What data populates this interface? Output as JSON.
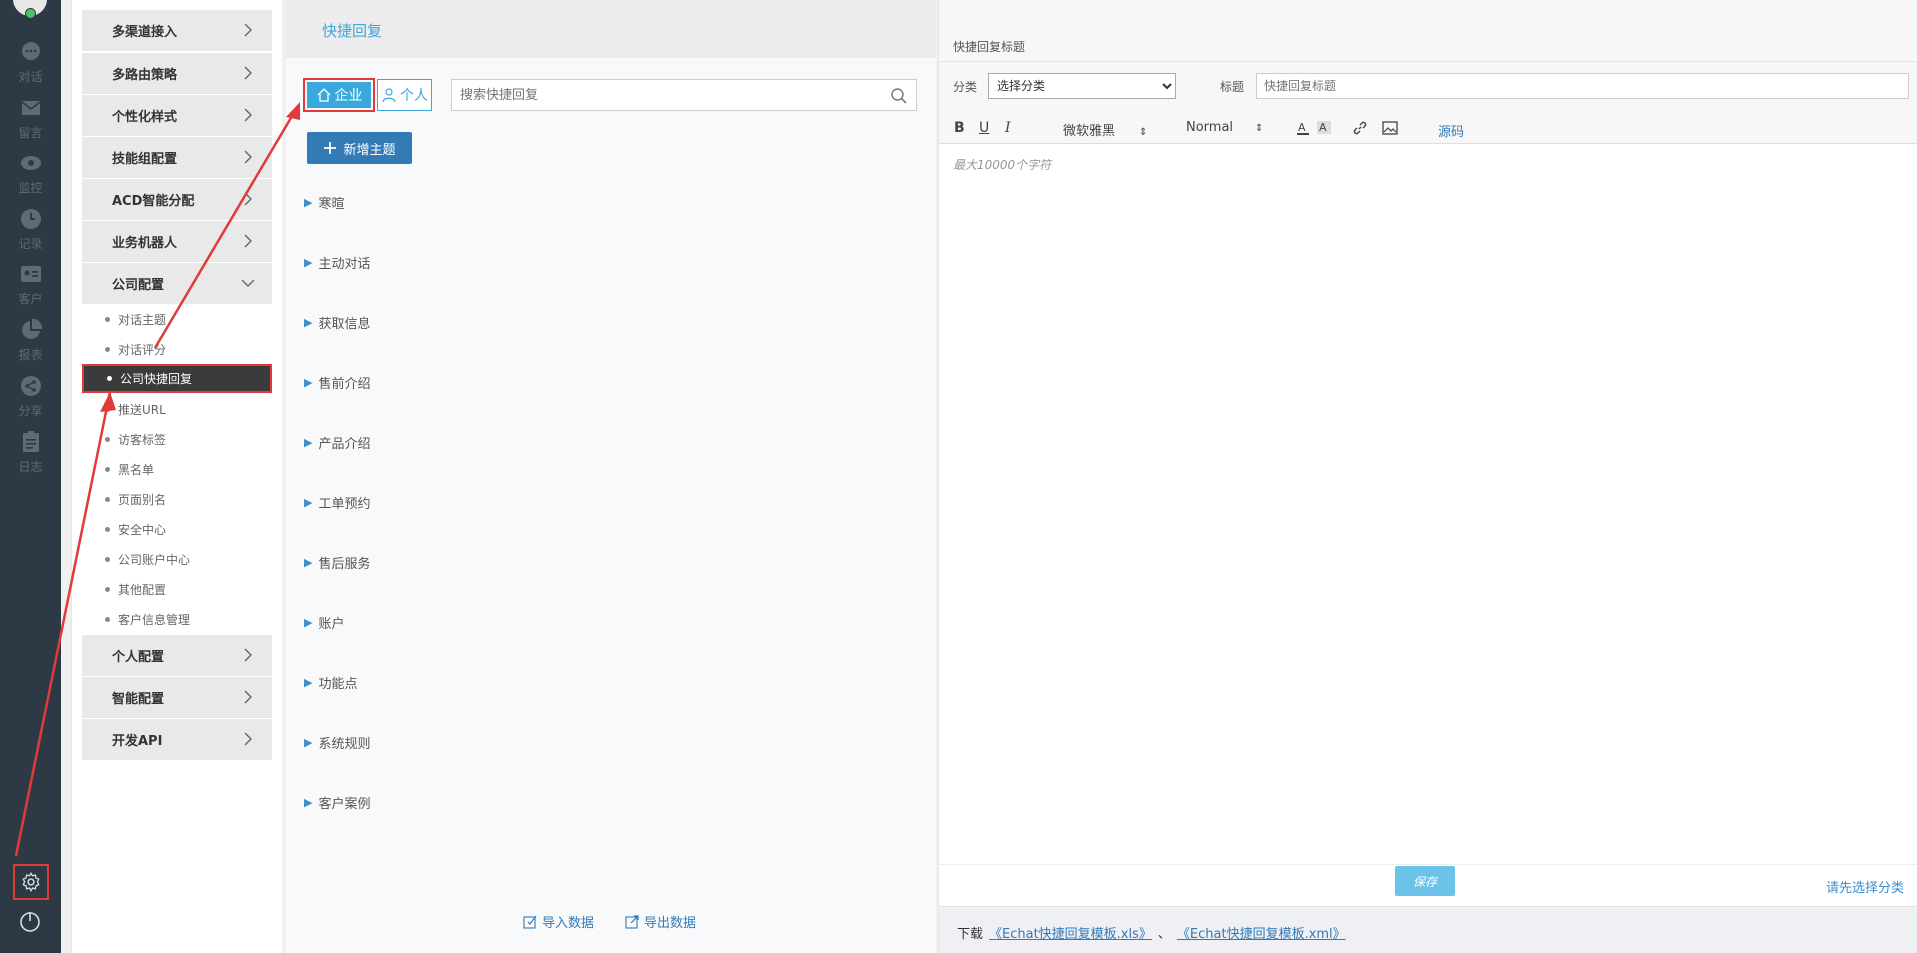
{
  "rail": {
    "items": [
      {
        "label": "对话",
        "icon": "chat-bubble-icon"
      },
      {
        "label": "留言",
        "icon": "envelope-icon"
      },
      {
        "label": "监控",
        "icon": "eye-icon"
      },
      {
        "label": "记录",
        "icon": "clock-icon"
      },
      {
        "label": "客户",
        "icon": "id-card-icon"
      },
      {
        "label": "报表",
        "icon": "pie-chart-icon"
      },
      {
        "label": "分享",
        "icon": "share-icon"
      },
      {
        "label": "日志",
        "icon": "clipboard-icon"
      }
    ],
    "bottom_icons": [
      "gear-icon",
      "power-icon"
    ]
  },
  "menu": {
    "groups": [
      {
        "label": "多渠道接入"
      },
      {
        "label": "多路由策略"
      },
      {
        "label": "个性化样式"
      },
      {
        "label": "技能组配置"
      },
      {
        "label": "ACD智能分配"
      },
      {
        "label": "业务机器人"
      },
      {
        "label": "公司配置"
      }
    ],
    "sub_items": [
      {
        "label": "对话主题"
      },
      {
        "label": "对话评分"
      },
      {
        "label": "公司快捷回复"
      },
      {
        "label": "推送URL"
      },
      {
        "label": "访客标签"
      },
      {
        "label": "黑名单"
      },
      {
        "label": "页面别名"
      },
      {
        "label": "安全中心"
      },
      {
        "label": "公司账户中心"
      },
      {
        "label": "其他配置"
      },
      {
        "label": "客户信息管理"
      }
    ],
    "bottom_groups": [
      {
        "label": "个人配置"
      },
      {
        "label": "智能配置"
      },
      {
        "label": "开发API"
      }
    ]
  },
  "middle": {
    "title": "快捷回复",
    "tab_enterprise": "企业",
    "tab_personal": "个人",
    "search_placeholder": "搜索快捷回复",
    "add_topic": "新增主题",
    "topics": [
      "寒暄",
      "主动对话",
      "获取信息",
      "售前介绍",
      "产品介绍",
      "工单预约",
      "售后服务",
      "账户",
      "功能点",
      "系统规则",
      "客户案例"
    ],
    "import_label": "导入数据",
    "export_label": "导出数据"
  },
  "right": {
    "section_title": "快捷回复标题",
    "category_label": "分类",
    "category_value": "选择分类",
    "title_label": "标题",
    "title_placeholder": "快捷回复标题",
    "toolbar": {
      "bold": "B",
      "underline": "U",
      "italic": "I",
      "font": "微软雅黑",
      "size": "Normal",
      "source": "源码"
    },
    "editor_placeholder": "最大10000个字符",
    "save_label": "保存",
    "hint": "请先选择分类",
    "download_prefix": "下载",
    "xls_link": "《Echat快捷回复模板.xls》",
    "separator": "、",
    "xml_link": "《Echat快捷回复模板.xml》"
  },
  "colors": {
    "rail": "#2d3a45",
    "accent": "#3aa8dd",
    "primary_button": "#337ab7",
    "annotation": "#e03a3a"
  }
}
